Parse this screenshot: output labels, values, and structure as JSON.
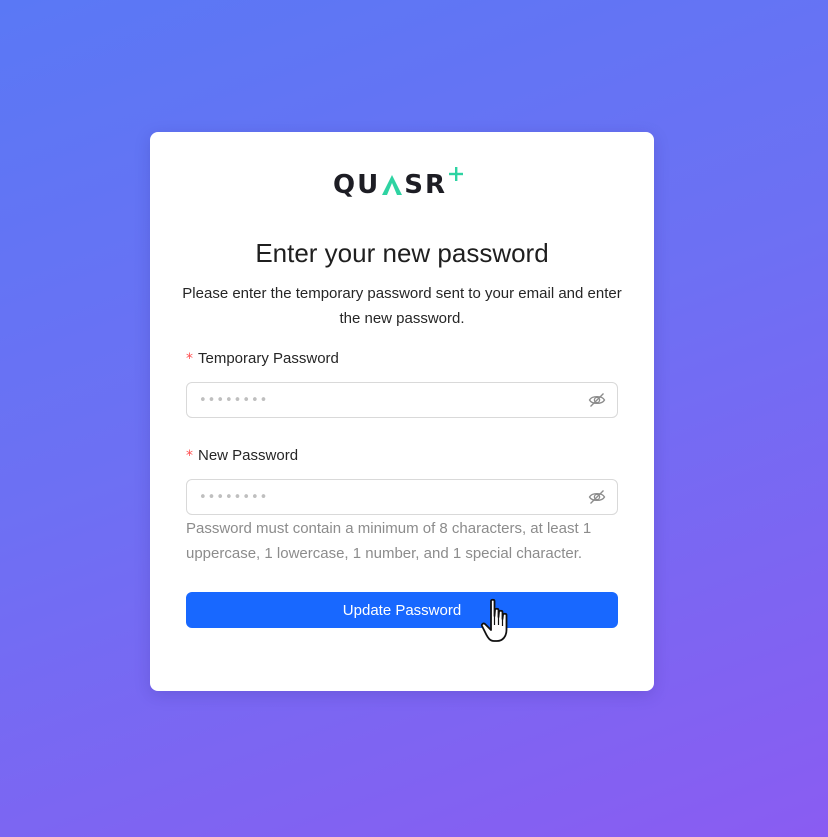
{
  "brand": {
    "logo_text_left": "QU",
    "logo_text_right": "SR",
    "logo_accent_color": "#2ed3a2"
  },
  "form": {
    "title": "Enter your new password",
    "subtitle": "Please enter the temporary password sent to your email and enter the new password.",
    "temporary_password": {
      "required_mark": "*",
      "label": "Temporary Password",
      "value": "••••••••",
      "visibility_icon": "eye-off-icon"
    },
    "new_password": {
      "required_mark": "*",
      "label": "New Password",
      "value": "••••••••",
      "visibility_icon": "eye-off-icon"
    },
    "hint": "Password must contain a minimum of 8 characters, at least 1 uppercase, 1 lowercase, 1 number, and 1 special character.",
    "submit_label": "Update Password"
  },
  "colors": {
    "primary": "#1868ff",
    "required": "#ff4d4f",
    "background_start": "#5a78f5",
    "background_end": "#8a5cf2"
  }
}
